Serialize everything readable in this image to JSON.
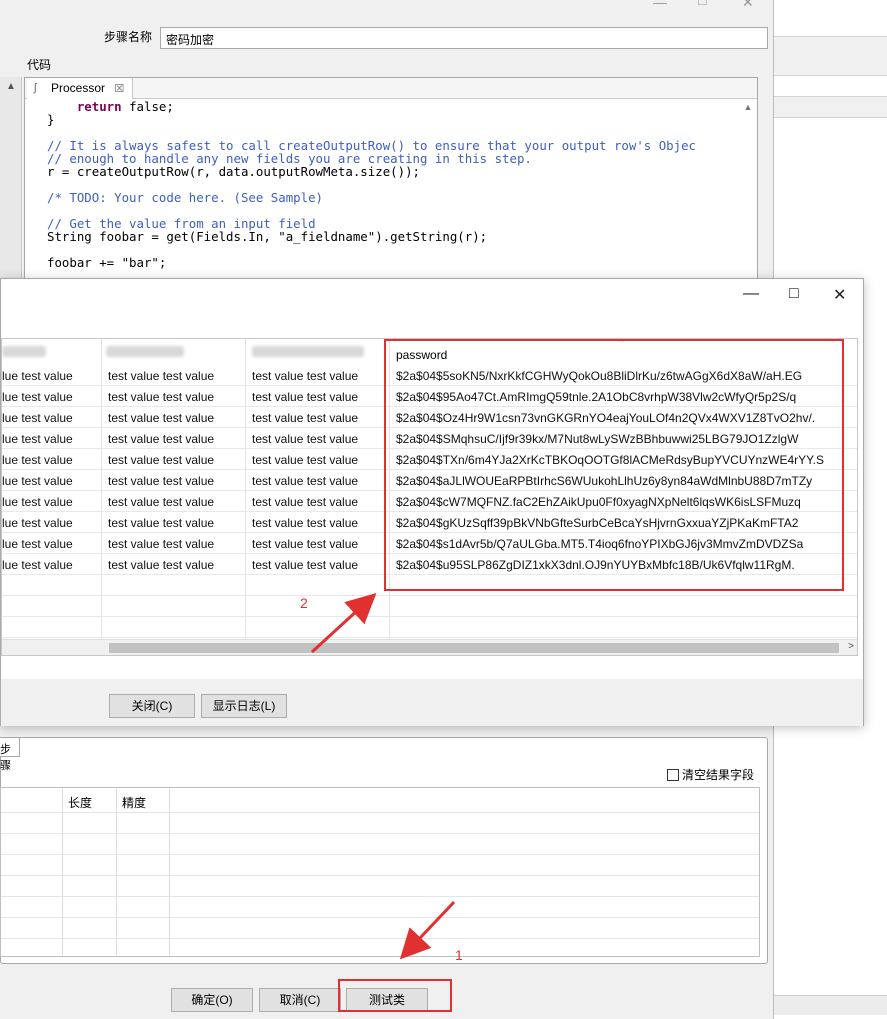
{
  "main_dialog": {
    "step_name_label": "步骤名称",
    "step_name_value": "密码加密",
    "code_label": "代码",
    "editor_tab_label": "Processor",
    "code_lines": [
      "  return false;",
      "}",
      "",
      "// It is always safest to call createOutputRow() to ensure that your output row's Objec",
      "// enough to handle any new fields you are creating in this step.",
      "r = createOutputRow(r, data.outputRowMeta.size());",
      "",
      "/* TODO: Your code here. (See Sample)",
      "",
      "// Get the value from an input field",
      "String foobar = get(Fields.In, \"a_fieldname\").getString(r);",
      "",
      "foobar += \"bar\";"
    ],
    "lower_tab_label": "步骤",
    "clear_result_fields_label": "清空结果字段",
    "grid_headers": [
      "长度",
      "精度"
    ],
    "buttons": {
      "ok": "确定(O)",
      "cancel": "取消(C)",
      "test": "测试类"
    }
  },
  "preview_dialog": {
    "column_header_password": "password",
    "rows": [
      {
        "c1": "lue test value",
        "c2": "test value test value",
        "c3": "test value test value",
        "password": "$2a$04$5soKN5/NxrKkfCGHWyQokOu8BliDlrKu/z6twAGgX6dX8aW/aH.EG"
      },
      {
        "c1": "lue test value",
        "c2": "test value test value",
        "c3": "test value test value",
        "password": "$2a$04$95Ao47Ct.AmRImgQ59tnle.2A1ObC8vrhpW38Vlw2cWfyQr5p2S/q"
      },
      {
        "c1": "lue test value",
        "c2": "test value test value",
        "c3": "test value test value",
        "password": "$2a$04$Oz4Hr9W1csn73vnGKGRnYO4eajYouLOf4n2QVx4WXV1Z8TvO2hv/."
      },
      {
        "c1": "lue test value",
        "c2": "test value test value",
        "c3": "test value test value",
        "password": "$2a$04$SMqhsuC/Ijf9r39kx/M7Nut8wLySWzBBhbuwwi25LBG79JO1ZzlgW"
      },
      {
        "c1": "lue test value",
        "c2": "test value test value",
        "c3": "test value test value",
        "password": "$2a$04$TXn/6m4YJa2XrKcTBKOqOOTGf8lACMeRdsyBupYVCUYnzWE4rYY.S"
      },
      {
        "c1": "lue test value",
        "c2": "test value test value",
        "c3": "test value test value",
        "password": "$2a$04$aJLlWOUEaRPBtIrhcS6WUukohLlhUz6y8yn84aWdMlnbU88D7mTZy"
      },
      {
        "c1": "lue test value",
        "c2": "test value test value",
        "c3": "test value test value",
        "password": "$2a$04$cW7MQFNZ.faC2EhZAikUpu0Ff0xyagNXpNelt6lqsWK6isLSFMuzq"
      },
      {
        "c1": "lue test value",
        "c2": "test value test value",
        "c3": "test value test value",
        "password": "$2a$04$gKUzSqff39pBkVNbGfteSurbCeBcaYsHjvrnGxxuaYZjPKaKmFTA2"
      },
      {
        "c1": "lue test value",
        "c2": "test value test value",
        "c3": "test value test value",
        "password": "$2a$04$s1dAvr5b/Q7aULGba.MT5.T4ioq6fnoYPIXbGJ6jv3MmvZmDVDZSa"
      },
      {
        "c1": "lue test value",
        "c2": "test value test value",
        "c3": "test value test value",
        "password": "$2a$04$u95SLP86ZgDIZ1xkX3dnl.OJ9nYUYBxMbfc18B/Uk6Vfqlw11RgM."
      }
    ],
    "buttons": {
      "close": "关闭(C)",
      "show_log": "显示日志(L)"
    }
  },
  "annotations": {
    "marker_1": "1",
    "marker_2": "2"
  },
  "colors": {
    "annotation_red": "#e03030",
    "keyword": "#7f0055",
    "comment": "#3f5fbf",
    "string": "#2a00ff"
  },
  "icons": [
    "minimize-icon",
    "maximize-icon",
    "close-icon",
    "java-file-icon",
    "tab-close-icon",
    "scroll-up-icon",
    "scroll-right-icon"
  ]
}
